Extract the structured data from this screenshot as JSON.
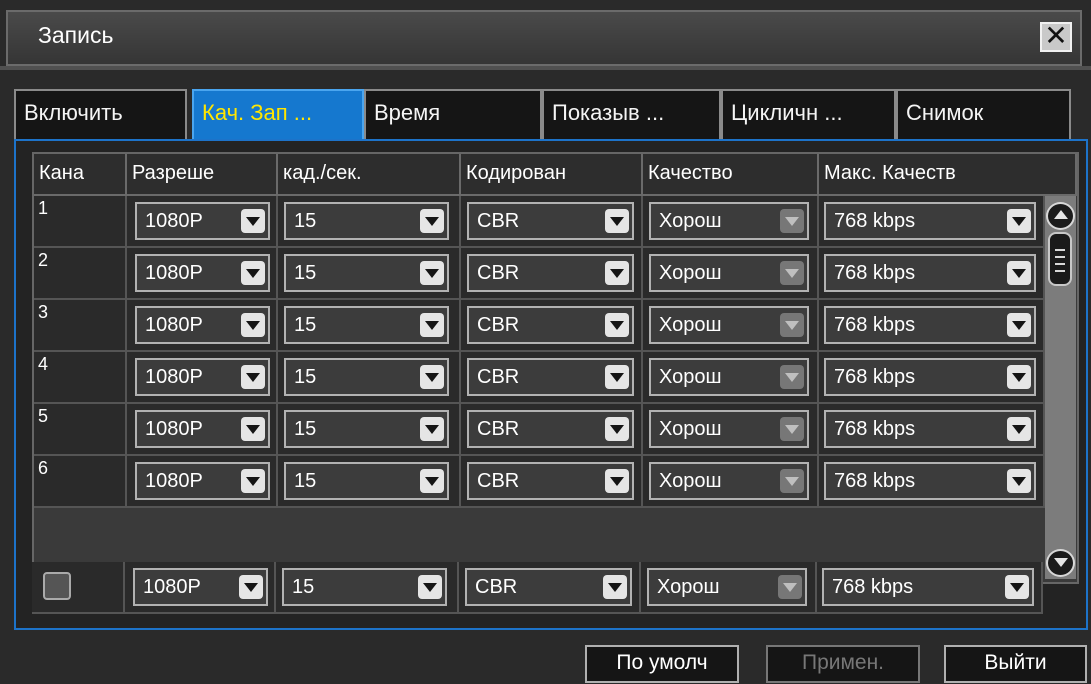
{
  "window": {
    "title": "Запись",
    "close_icon": "close-icon"
  },
  "tabs": [
    {
      "label": "Включить",
      "active": false
    },
    {
      "label": "Кач. Зап ...",
      "active": true
    },
    {
      "label": "Время",
      "active": false
    },
    {
      "label": "Показыв ...",
      "active": false
    },
    {
      "label": "Цикличн ...",
      "active": false
    },
    {
      "label": "Снимок",
      "active": false
    }
  ],
  "table": {
    "headers": [
      "Кана",
      "Разреше",
      "кад./сек.",
      "Кодирован",
      "Качество",
      "Макс. Качеств"
    ],
    "rows": [
      {
        "channel": "1",
        "resolution": "1080P",
        "fps": "15",
        "encoding": "CBR",
        "quality": "Хорош",
        "max_quality": "768 kbps"
      },
      {
        "channel": "2",
        "resolution": "1080P",
        "fps": "15",
        "encoding": "CBR",
        "quality": "Хорош",
        "max_quality": "768 kbps"
      },
      {
        "channel": "3",
        "resolution": "1080P",
        "fps": "15",
        "encoding": "CBR",
        "quality": "Хорош",
        "max_quality": "768 kbps"
      },
      {
        "channel": "4",
        "resolution": "1080P",
        "fps": "15",
        "encoding": "CBR",
        "quality": "Хорош",
        "max_quality": "768 kbps"
      },
      {
        "channel": "5",
        "resolution": "1080P",
        "fps": "15",
        "encoding": "CBR",
        "quality": "Хорош",
        "max_quality": "768 kbps"
      },
      {
        "channel": "6",
        "resolution": "1080P",
        "fps": "15",
        "encoding": "CBR",
        "quality": "Хорош",
        "max_quality": "768 kbps"
      }
    ],
    "all_row": {
      "resolution": "1080P",
      "fps": "15",
      "encoding": "CBR",
      "quality": "Хорош",
      "max_quality": "768 kbps"
    }
  },
  "buttons": {
    "default": "По умолч",
    "apply": "Примен.",
    "exit": "Выйти"
  },
  "colors": {
    "active_tab": "#1578cf",
    "active_tab_text": "#ffe600",
    "panel_border": "#1d73c9"
  }
}
